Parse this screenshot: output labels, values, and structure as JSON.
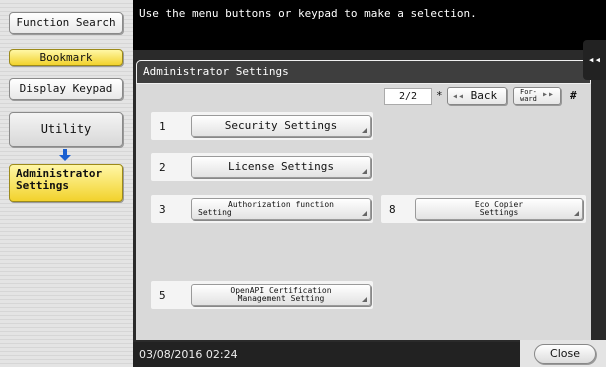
{
  "sidebar": {
    "function_search": "Function Search",
    "bookmark": "Bookmark",
    "display_keypad": "Display Keypad",
    "utility": "Utility",
    "admin_settings_line1": "Administrator",
    "admin_settings_line2": "Settings"
  },
  "banner": {
    "message": "Use the menu buttons or keypad to make a selection.",
    "collapse_glyph": "◂◂"
  },
  "window": {
    "title": "Administrator Settings",
    "pager": "2/2",
    "star": "*",
    "back_label": "Back",
    "back_glyph": "◂◂",
    "forward_line1": "For-",
    "forward_line2": "ward",
    "forward_glyph": "▸▸",
    "hash": "#"
  },
  "menu": {
    "items": [
      {
        "number": "1",
        "line1": "Security Settings",
        "line2": ""
      },
      {
        "number": "2",
        "line1": "License Settings",
        "line2": ""
      },
      {
        "number": "3",
        "line1": "Authorization function",
        "line2": "Setting"
      },
      {
        "number": "8",
        "line1": "Eco Copier",
        "line2": "Settings"
      },
      {
        "number": "5",
        "line1": "OpenAPI Certification",
        "line2": "Management Setting"
      }
    ]
  },
  "status": {
    "datetime": "03/08/2016  02:24",
    "close_label": "Close"
  },
  "colors": {
    "accent_yellow": "#f2d22c",
    "banner_black": "#000000",
    "arrow_blue": "#1a5fd0"
  },
  "icons": {
    "arrow": "arrow-down-icon"
  }
}
